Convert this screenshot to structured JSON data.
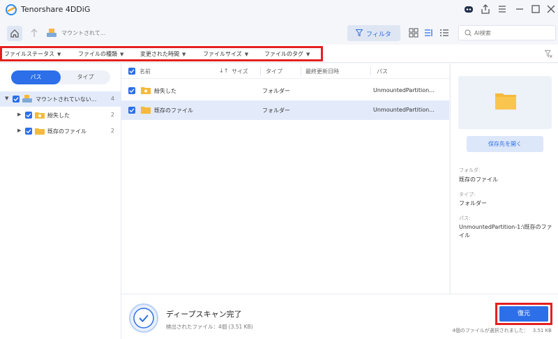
{
  "app": {
    "title": "Tenorshare 4DDiG"
  },
  "nav": {
    "path": "マウントされて...",
    "filter_label": "フィルタ",
    "search_placeholder": "AI検索"
  },
  "filters": [
    {
      "label": "ファイルステータス"
    },
    {
      "label": "ファイルの種類"
    },
    {
      "label": "変更された時間"
    },
    {
      "label": "ファイルサイズ"
    },
    {
      "label": "ファイルのタグ"
    }
  ],
  "sidebar": {
    "tabs": {
      "path": "パス",
      "type": "タイプ"
    },
    "tree": [
      {
        "label": "マウントされていない...",
        "count": "4"
      },
      {
        "label": "紛失した",
        "count": "2"
      },
      {
        "label": "既存のファイル",
        "count": "2"
      }
    ]
  },
  "list": {
    "headers": {
      "name": "名前",
      "size": "サイズ",
      "type": "タイプ",
      "modified": "最終更新日時",
      "path": "パス"
    },
    "rows": [
      {
        "name": "紛失した",
        "type": "フォルダー",
        "path": "UnmountedPartition..."
      },
      {
        "name": "既存のファイル",
        "type": "フォルダー",
        "path": "UnmountedPartition..."
      }
    ]
  },
  "preview": {
    "open_label": "保存先を開く",
    "folder_label": "フォルダ:",
    "folder_value": "既存のファイル",
    "type_label": "タイプ:",
    "type_value": "フォルダー",
    "path_label": "パス:",
    "path_value": "UnmountedPartition-1:\\既存のファイル"
  },
  "status": {
    "title": "ディープスキャン完了",
    "detected": "検出されたファイル：4個 (3.51 KB)",
    "recover_label": "復元",
    "selected_text": "4個のファイルが選択されました：",
    "selected_size": "3.51 KB"
  },
  "colors": {
    "accent": "#2c6fe8",
    "highlight": "#e4201f",
    "folder": "#f6b93b"
  }
}
